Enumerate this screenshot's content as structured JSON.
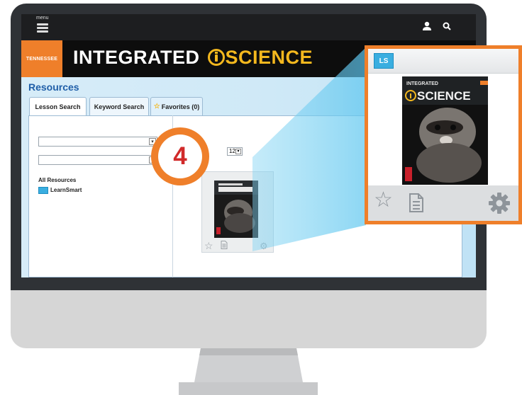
{
  "topbar": {
    "menu_label": "menu"
  },
  "brand": {
    "state": "TENNESSEE",
    "title_part1": "INTEGRATED ",
    "title_part2": "SCIENCE"
  },
  "resources": {
    "title": "Resources",
    "tabs": [
      {
        "label": "Lesson Search"
      },
      {
        "label": "Keyword Search"
      },
      {
        "label": "Favorites (0)"
      }
    ],
    "all_resources_label": "All Resources",
    "learnsmart_label": "LearnSmart",
    "per_page_value": "12"
  },
  "callout": {
    "logo_text": "LS",
    "book_title_top": "INTEGRATED",
    "book_title_main": "SCIENCE"
  },
  "step_number": "4",
  "colors": {
    "accent_orange": "#ef7f2a",
    "science_yellow": "#f4b81e",
    "link_blue": "#1f5ea8",
    "learnsmart_blue": "#3aaee0"
  },
  "icons": [
    "menu-icon",
    "user-icon",
    "search-icon",
    "star-icon",
    "document-icon",
    "gear-icon",
    "learnsmart-icon"
  ]
}
